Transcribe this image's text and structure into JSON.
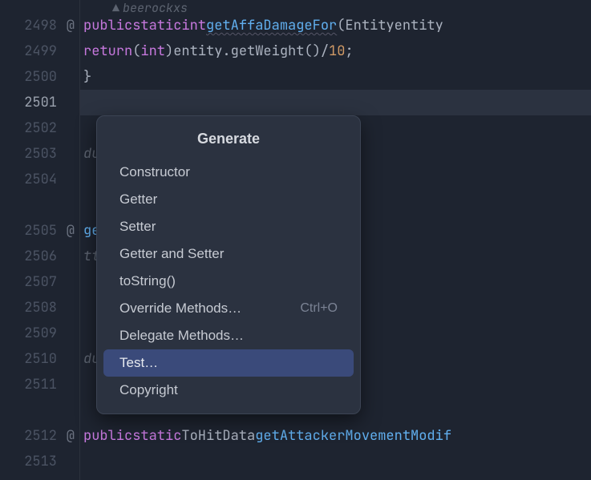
{
  "gutter": {
    "lines": [
      {
        "num": "",
        "mark": ""
      },
      {
        "num": "2498",
        "mark": "@"
      },
      {
        "num": "2499",
        "mark": ""
      },
      {
        "num": "2500",
        "mark": ""
      },
      {
        "num": "2501",
        "mark": "",
        "current": true
      },
      {
        "num": "2502",
        "mark": ""
      },
      {
        "num": "2503",
        "mark": ""
      },
      {
        "num": "2504",
        "mark": ""
      },
      {
        "num": "",
        "mark": ""
      },
      {
        "num": "2505",
        "mark": "@"
      },
      {
        "num": "2506",
        "mark": ""
      },
      {
        "num": "2507",
        "mark": ""
      },
      {
        "num": "2508",
        "mark": ""
      },
      {
        "num": "2509",
        "mark": ""
      },
      {
        "num": "2510",
        "mark": ""
      },
      {
        "num": "2511",
        "mark": ""
      },
      {
        "num": "",
        "mark": ""
      },
      {
        "num": "2512",
        "mark": "@"
      },
      {
        "num": "2513",
        "mark": ""
      }
    ]
  },
  "code": {
    "author": "beerockxs",
    "kw_public": "public",
    "kw_static": "static",
    "kw_int": "int",
    "kw_return": "return",
    "method_getAffa": "getAffaDamageFor",
    "entity_type": "Entity",
    "entity_param": "entity",
    "cast_int": "int",
    "call_getWeight": "entity.getWeight()",
    "div": "/",
    "ten": "10",
    "semi": ";",
    "brace_close": "}",
    "comment_attacker": "due to attacker movement",
    "tohitdata": "ToHitData",
    "method_attacker_mod": "getAttackerMovementModif",
    "call_attacker_mod": "ttackerMovementModifier",
    "g_arg": "g"
  },
  "popup": {
    "title": "Generate",
    "items": [
      {
        "label": "Constructor",
        "shortcut": ""
      },
      {
        "label": "Getter",
        "shortcut": ""
      },
      {
        "label": "Setter",
        "shortcut": ""
      },
      {
        "label": "Getter and Setter",
        "shortcut": ""
      },
      {
        "label": "toString()",
        "shortcut": ""
      },
      {
        "label": "Override Methods…",
        "shortcut": "Ctrl+O"
      },
      {
        "label": "Delegate Methods…",
        "shortcut": ""
      },
      {
        "label": "Test…",
        "shortcut": "",
        "selected": true
      },
      {
        "label": "Copyright",
        "shortcut": ""
      }
    ]
  }
}
